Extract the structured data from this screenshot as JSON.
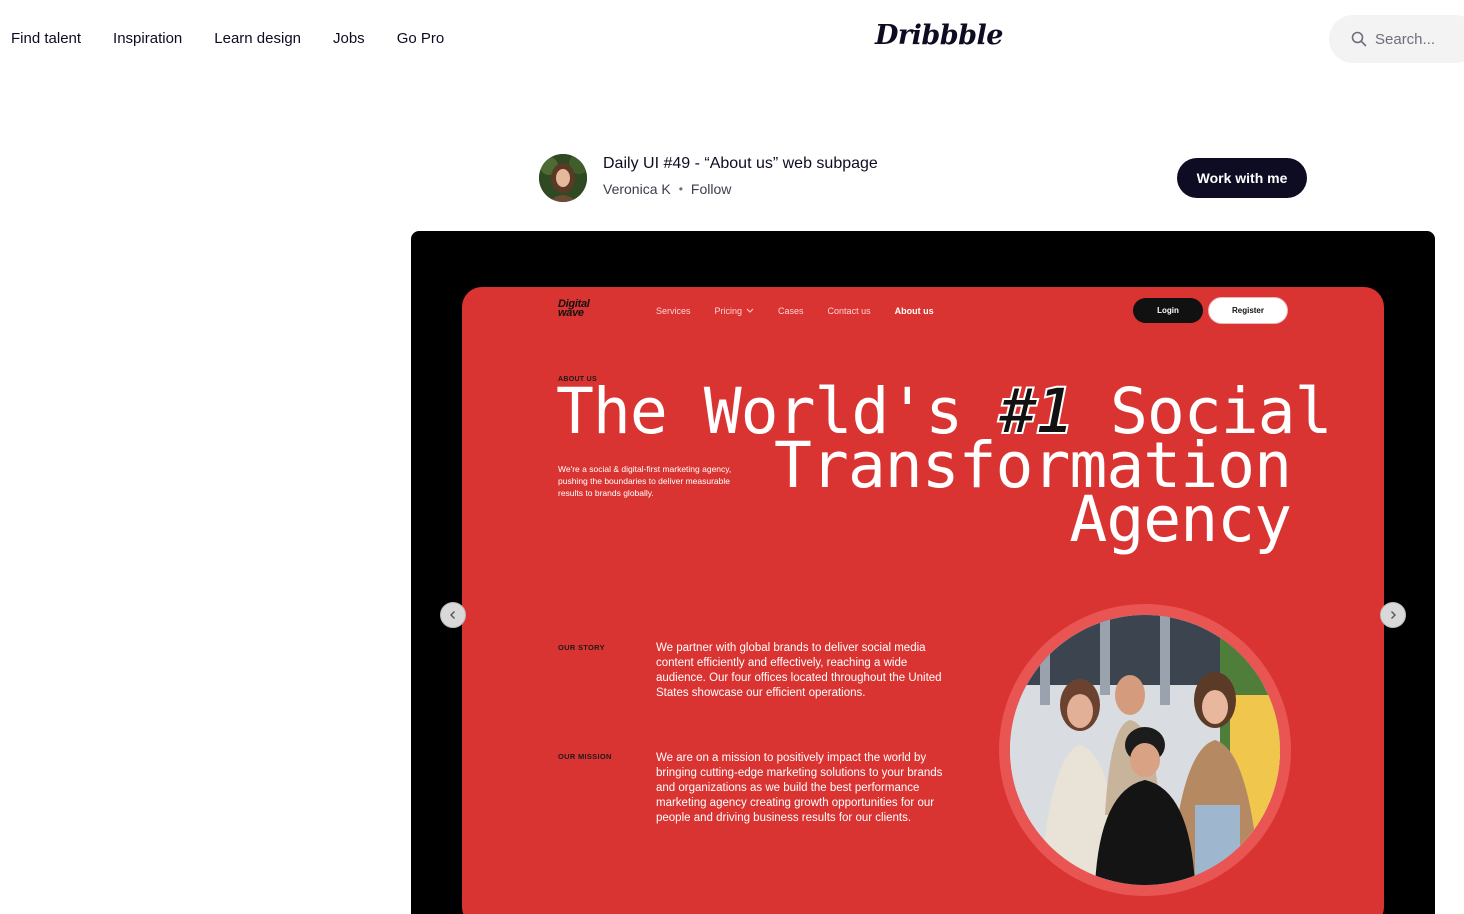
{
  "nav": {
    "links": [
      "Find talent",
      "Inspiration",
      "Learn design",
      "Jobs",
      "Go Pro"
    ],
    "logo": "Dribbble",
    "search_placeholder": "Search..."
  },
  "shot": {
    "title": "Daily UI #49 - “About us” web subpage",
    "author": "Veronica K",
    "separator": "•",
    "follow_label": "Follow",
    "cta_label": "Work with me"
  },
  "site": {
    "logo_line1": "Digital",
    "logo_line2": "wave",
    "nav": [
      "Services",
      "Pricing",
      "Cases",
      "Contact us",
      "About us"
    ],
    "login_label": "Login",
    "register_label": "Register",
    "eyebrow": "ABOUT US",
    "headline_l1_a": "The World's ",
    "headline_l1_num": "#1",
    "headline_l1_b": " Social",
    "headline_l2": "Transformation",
    "headline_l3": "Agency",
    "intro": "We're a social & digital-first marketing agency, pushing the boundaries to deliver measurable results to brands globally.",
    "story_label": "OUR STORY",
    "story_text": "We partner with global brands to deliver social media content efficiently and effectively, reaching a wide audience. Our four offices located throughout the United States showcase our efficient operations.",
    "mission_label": "OUR MISSION",
    "mission_text": "We are on a mission to positively impact the world by bringing cutting-edge marketing solutions to your brands and organizations as we build the best performance marketing agency creating growth opportunities for our people and driving business results for our clients."
  },
  "colors": {
    "brand_dark": "#0d0c22",
    "site_red": "#da3432"
  }
}
